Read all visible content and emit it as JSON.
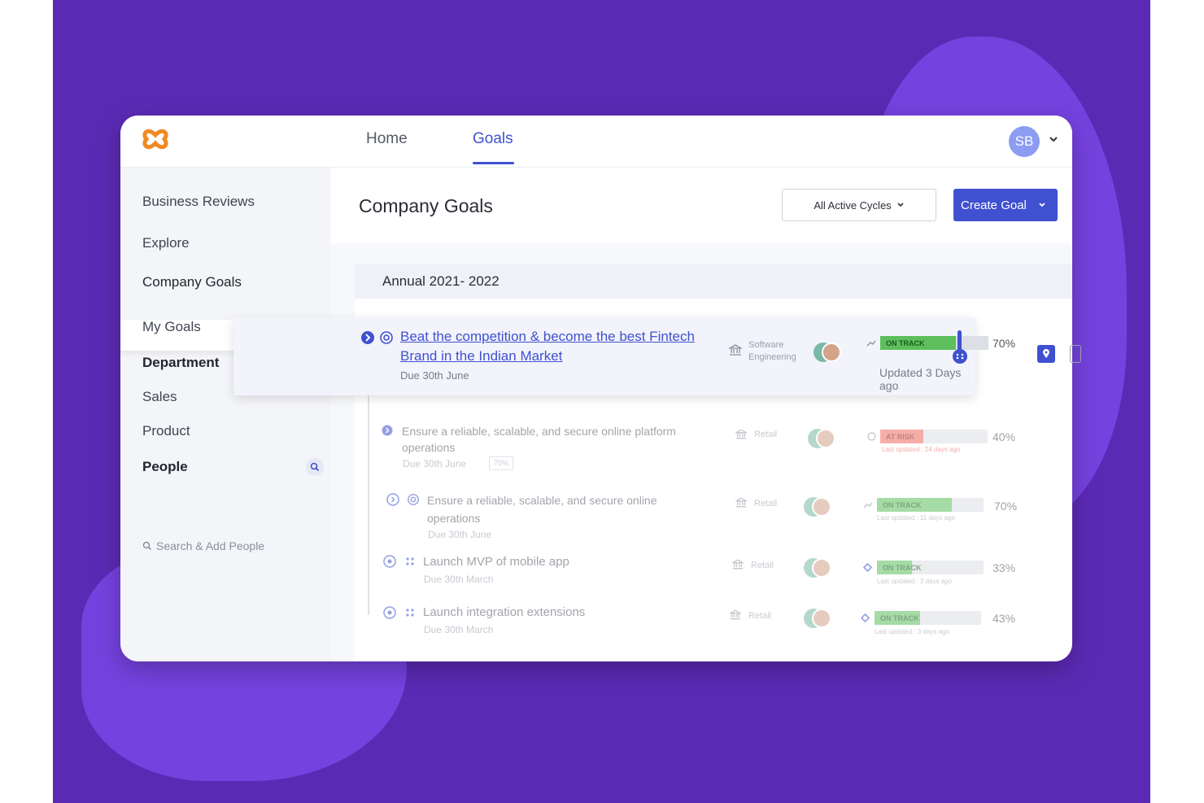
{
  "topbar": {
    "nav": [
      {
        "label": "Home"
      },
      {
        "label": "Goals",
        "active": true
      }
    ],
    "avatar_initials": "SB"
  },
  "sidebar": {
    "items": [
      {
        "label": "Business Reviews"
      },
      {
        "label": "Explore"
      },
      {
        "label": "Company Goals",
        "active": true
      },
      {
        "label": "My Goals"
      },
      {
        "label": "Department",
        "section": true
      },
      {
        "label": "Sales"
      },
      {
        "label": "Product"
      },
      {
        "label": "People",
        "section": true
      }
    ],
    "people_search": "Search & Add People"
  },
  "main": {
    "title": "Company Goals",
    "cycle_select": "All Active Cycles",
    "create_button": "Create Goal",
    "cycle_header": "Annual 2021- 2022"
  },
  "goals": [
    {
      "title_line1": "Beat the competition & become the best Fintech",
      "title_line2": "Brand in the Indian Market",
      "due": "Due 30th June",
      "team_line1": "Software",
      "team_line2": "Engineering",
      "status": "ON TRACK",
      "progress": 70,
      "progress_label": "70%",
      "updated": "Updated 3 Days ago"
    },
    {
      "title_line1": "Ensure a reliable, scalable, and secure online platform",
      "title_line2": "operations",
      "due": "Due 30th June",
      "weight": "70%",
      "team": "Retail",
      "status": "AT RISK",
      "progress": 40,
      "progress_label": "40%",
      "updated": "Last updated : 24 days ago"
    },
    {
      "title_line1": "Ensure a reliable, scalable, and secure online",
      "title_line2": "operations",
      "due": "Due 30th June",
      "team": "Retail",
      "status": "ON TRACK",
      "progress": 70,
      "progress_label": "70%",
      "updated": "Last updated : 11 days ago"
    },
    {
      "title_line1": "Launch MVP of mobile app",
      "due": "Due 30th March",
      "team": "Retail",
      "status": "ON TRACK",
      "progress": 33,
      "progress_label": "33%",
      "updated": "Last updated : 3 days ago"
    },
    {
      "title_line1": "Launch integration extensions",
      "due": "Due 30th March",
      "team": "Retail",
      "status": "ON TRACK",
      "progress": 43,
      "progress_label": "43%",
      "updated": "Last updated : 3 days ago"
    }
  ],
  "colors": {
    "accent": "#3f51d0",
    "on_track": "#5cbf5c",
    "at_risk": "#ef6b63",
    "background": "#5b2ab4",
    "logo": "#f08a24"
  },
  "icons": [
    "logo-icon",
    "chevron-down-icon",
    "search-icon",
    "expand-icon",
    "goal-icon",
    "team-icon",
    "trend-icon",
    "drag-handle-icon",
    "location-icon",
    "more-icon"
  ]
}
